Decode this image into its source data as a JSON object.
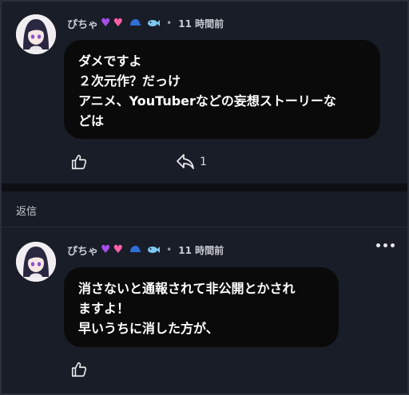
{
  "comment": {
    "username": "ぴちゃ",
    "time": "11 時間前",
    "lines": [
      "ダメですよ",
      "２次元作？だっけ",
      "アニメ、YouTuberなどの妄想ストーリーな",
      "どは"
    ],
    "reply_count": "1",
    "icons": [
      "avatar",
      "purple-heart-icon",
      "pink-heart-icon",
      "blue-cap-icon",
      "fish-icon",
      "thumbs-up-icon",
      "share-icon"
    ]
  },
  "reply_section": {
    "label": "返信"
  },
  "reply": {
    "username": "ぴちゃ",
    "time": "11 時間前",
    "lines": [
      "消さないと通報されて非公開とかされ",
      "ますよ！",
      "早いうちに消した方が、"
    ],
    "icons": [
      "avatar",
      "purple-heart-icon",
      "pink-heart-icon",
      "blue-cap-icon",
      "fish-icon",
      "thumbs-up-icon",
      "more-icon"
    ]
  },
  "colors": {
    "background": "#171c26",
    "bubble": "#0a0a0a",
    "purple_heart": "#a64ee6",
    "pink_heart": "#ff5fa8"
  }
}
